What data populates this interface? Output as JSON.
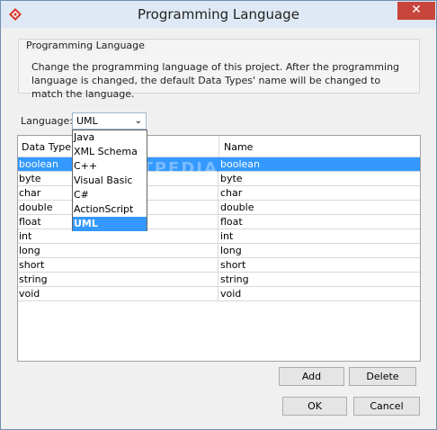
{
  "window": {
    "title": "Programming Language",
    "close_glyph": "✕"
  },
  "group": {
    "title": "Programming Language",
    "description": "Change the programming language of this project. After the programming language is changed, the default Data Types' name will be changed to match the language."
  },
  "language": {
    "label": "Language:",
    "selected": "UML",
    "options": [
      "Java",
      "XML Schema",
      "C++",
      "Visual Basic",
      "C#",
      "ActionScript",
      "UML"
    ]
  },
  "table": {
    "columns": [
      "Data Type",
      "Name"
    ],
    "rows": [
      [
        "boolean",
        "boolean"
      ],
      [
        "byte",
        "byte"
      ],
      [
        "char",
        "char"
      ],
      [
        "double",
        "double"
      ],
      [
        "float",
        "float"
      ],
      [
        "int",
        "int"
      ],
      [
        "long",
        "long"
      ],
      [
        "short",
        "short"
      ],
      [
        "string",
        "string"
      ],
      [
        "void",
        "void"
      ]
    ],
    "selected_row": 0
  },
  "watermark": "SOFTPEDIA",
  "buttons": {
    "add": "Add",
    "delete": "Delete",
    "ok": "OK",
    "cancel": "Cancel"
  },
  "colors": {
    "selection": "#3399ff",
    "close_button": "#c7453b",
    "titlebar": "#dfe9f5"
  }
}
